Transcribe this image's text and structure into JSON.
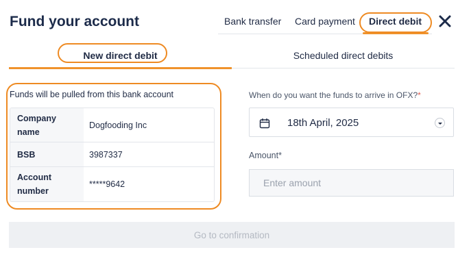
{
  "page": {
    "title": "Fund your account"
  },
  "top_tabs": {
    "bank_transfer": "Bank transfer",
    "card_payment": "Card payment",
    "direct_debit": "Direct debit",
    "active": "Direct debit"
  },
  "sub_tabs": {
    "new_direct_debit": "New direct debit",
    "scheduled_direct_debits": "Scheduled direct debits",
    "active": "New direct debit"
  },
  "bank_account": {
    "intro": "Funds will be pulled from this bank account",
    "rows": [
      {
        "label_line1": "Company",
        "label_line2": "name",
        "value": "Dogfooding Inc"
      },
      {
        "label": "BSB",
        "value": "3987337"
      },
      {
        "label_line1": "Account",
        "label_line2": "number",
        "value": "*****9642"
      }
    ]
  },
  "arrival": {
    "label": "When do you want the funds to arrive in OFX?",
    "required_mark": "*",
    "date_value": "18th April, 2025"
  },
  "amount": {
    "label": "Amount",
    "required_mark": "*",
    "placeholder": "Enter amount",
    "value": ""
  },
  "actions": {
    "confirm_label": "Go to confirmation",
    "confirm_enabled": false
  },
  "colors": {
    "accent": "#f0922b",
    "highlight_outline": "#ee8a22",
    "title": "#1c2b4a",
    "required": "#e05a4e"
  },
  "icons": {
    "close": "close-icon",
    "calendar": "calendar-icon",
    "dropdown": "chevron-down-icon"
  }
}
